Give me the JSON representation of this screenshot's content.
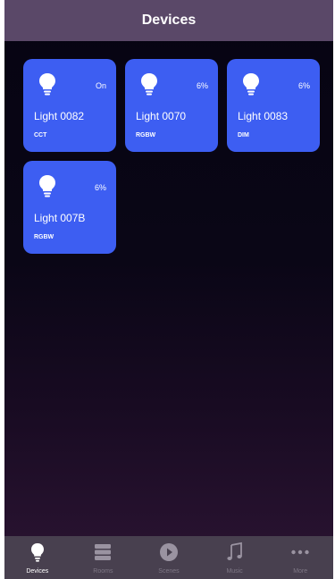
{
  "header": {
    "title": "Devices"
  },
  "devices": [
    {
      "name": "Light 0082",
      "status": "On",
      "type": "CCT"
    },
    {
      "name": "Light 0070",
      "status": "6%",
      "type": "RGBW"
    },
    {
      "name": "Light 0083",
      "status": "6%",
      "type": "DIM"
    },
    {
      "name": "Light 007B",
      "status": "6%",
      "type": "RGBW"
    }
  ],
  "tabs": [
    {
      "label": "Devices",
      "icon": "bulb-icon",
      "active": true
    },
    {
      "label": "Rooms",
      "icon": "rooms-icon",
      "active": false
    },
    {
      "label": "Scenes",
      "icon": "scenes-icon",
      "active": false
    },
    {
      "label": "Music",
      "icon": "music-note-icon",
      "active": false
    },
    {
      "label": "More",
      "icon": "more-dots-icon",
      "active": false
    }
  ],
  "colors": {
    "card": "#3d5ef2",
    "header": "#5a4868",
    "tabbar": "#48404f",
    "tab_inactive": "#7e7785"
  }
}
